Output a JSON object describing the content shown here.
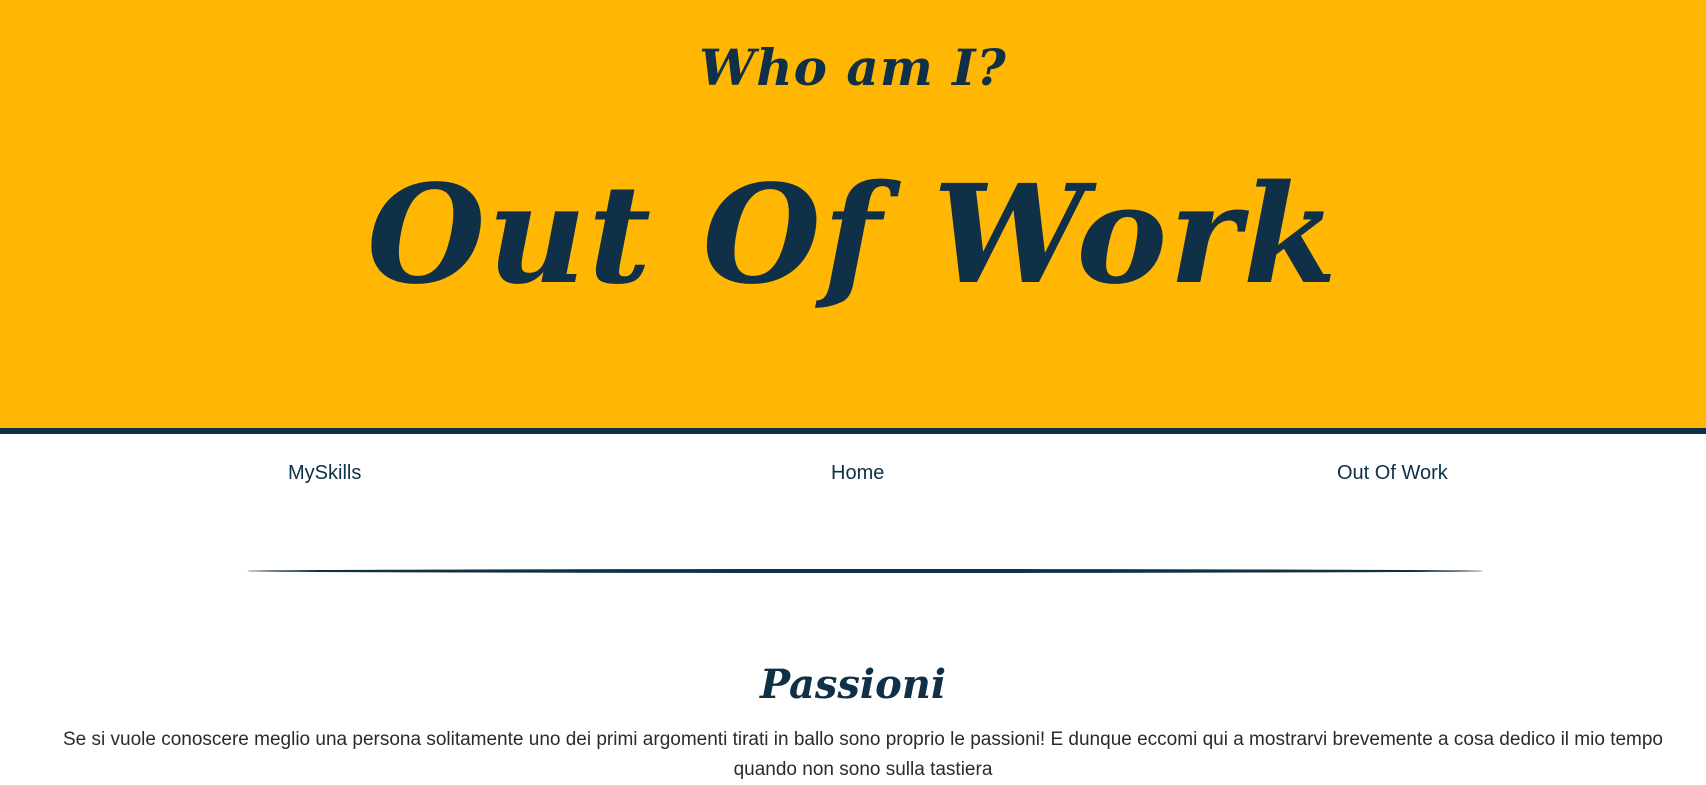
{
  "colors": {
    "hero_background": "#ffb703",
    "primary_dark": "#0f3046",
    "text": "#2b2b2b",
    "page_background": "#ffffff"
  },
  "hero": {
    "subtitle": "Who am I?",
    "title": "Out Of Work"
  },
  "nav": {
    "items": [
      {
        "label": "MySkills"
      },
      {
        "label": "Home"
      },
      {
        "label": "Out Of Work"
      }
    ]
  },
  "section": {
    "title": "Passioni",
    "text": "Se si vuole conoscere meglio una persona solitamente uno dei primi argomenti tirati in ballo sono proprio le passioni! E dunque eccomi qui a mostrarvi brevemente a cosa dedico il mio tempo quando non sono sulla tastiera"
  }
}
